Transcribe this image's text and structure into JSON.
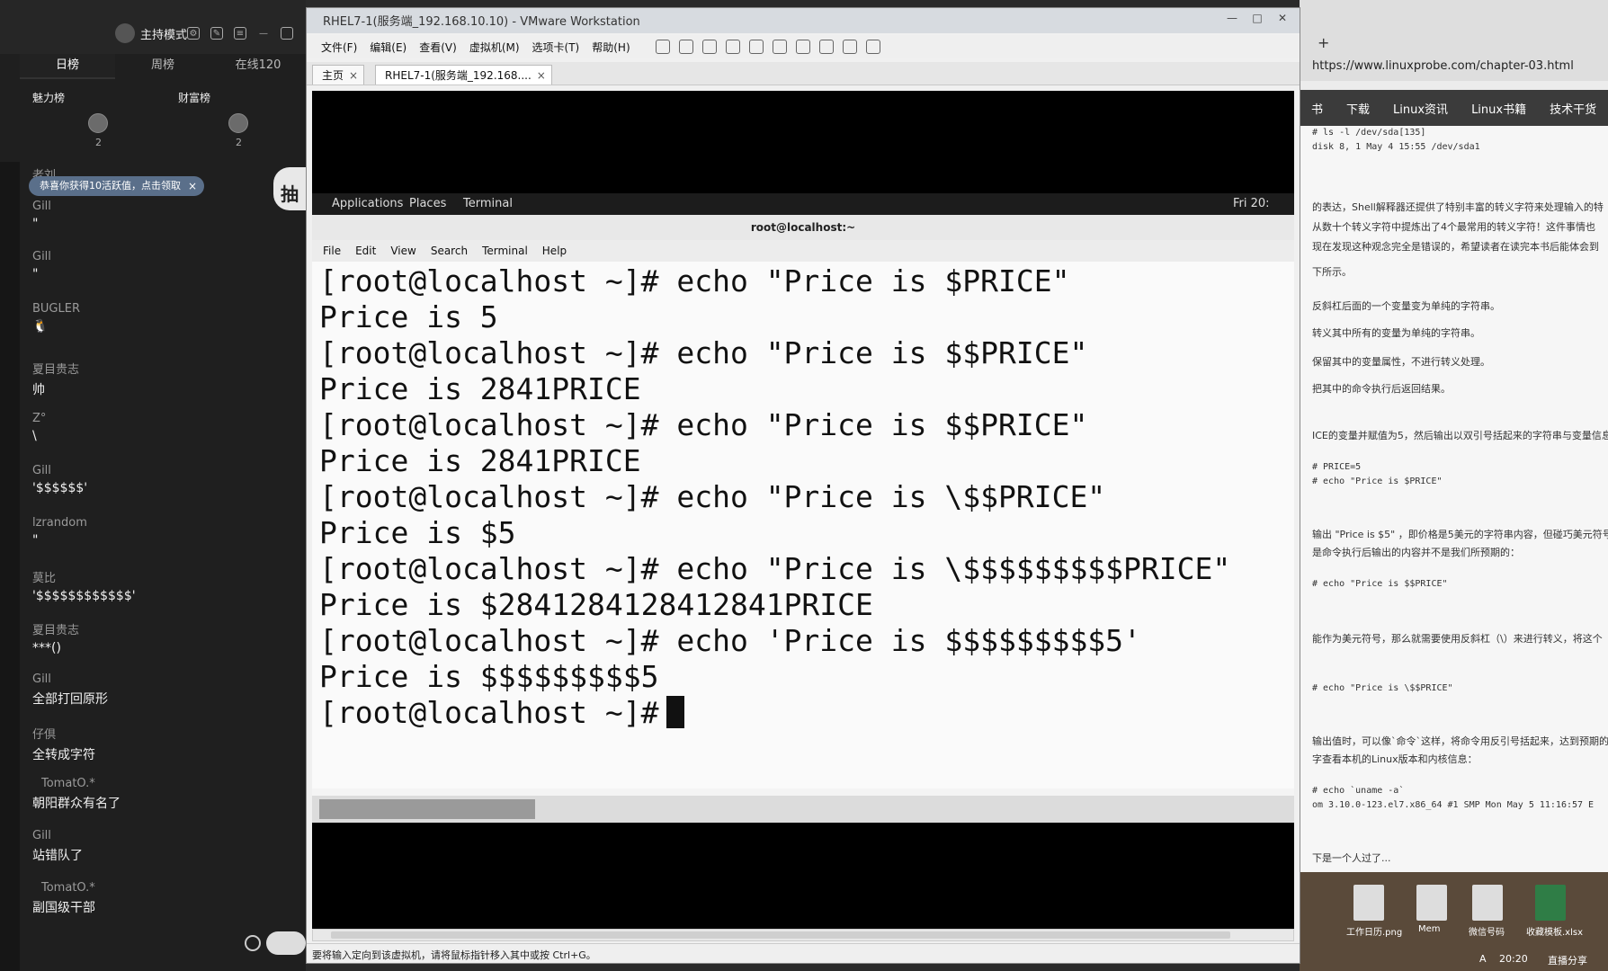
{
  "live": {
    "mode_label": "主持模式",
    "tabs": [
      "日榜",
      "周榜",
      "在线120"
    ],
    "rank": {
      "left_label": "魅力榜",
      "right_label": "财富榜",
      "left_count": "2",
      "right_count": "2"
    },
    "notice": "恭喜你获得10活跃值，点击领取",
    "notice_close": "×",
    "badge": "抽",
    "messages": [
      {
        "user": "老刘",
        "text": ""
      },
      {
        "user": "Gill",
        "text": "\""
      },
      {
        "user": "Gill",
        "text": "\""
      },
      {
        "user": "BUGLER",
        "text": "🐧"
      },
      {
        "user": "夏目贵志",
        "text": "帅"
      },
      {
        "user": "Z°",
        "text": "\\"
      },
      {
        "user": "Gill",
        "text": "'$$$$$$'"
      },
      {
        "user": "lzrandom",
        "text": "\""
      },
      {
        "user": "莫比",
        "text": "'$$$$$$$$$$$$'"
      },
      {
        "user": "夏目贵志",
        "text": "***()"
      },
      {
        "user": "Gill",
        "text": "全部打回原形"
      },
      {
        "user": "仔倶",
        "text": "全转成字符"
      },
      {
        "user": "TomatO.*",
        "text": "朝阳群众有名了"
      },
      {
        "user": "Gill",
        "text": "站错队了"
      },
      {
        "user": "TomatO.*",
        "text": "副国级干部"
      }
    ]
  },
  "vmware": {
    "title": "RHEL7-1(服务端_192.168.10.10) - VMware Workstation",
    "menu": [
      "文件(F)",
      "编辑(E)",
      "查看(V)",
      "虚拟机(M)",
      "选项卡(T)",
      "帮助(H)"
    ],
    "tabs": [
      {
        "label": "主页",
        "close": "×"
      },
      {
        "label": "RHEL7-1(服务端_192.168....",
        "close": "×"
      }
    ],
    "status": "要将输入定向到该虚拟机，请将鼠标指针移入其中或按 Ctrl+G。"
  },
  "gnome": {
    "panel": {
      "applications": "Applications",
      "places": "Places",
      "terminal": "Terminal",
      "clock": "Fri 20:"
    },
    "term_title": "root@localhost:~",
    "term_menu": [
      "File",
      "Edit",
      "View",
      "Search",
      "Terminal",
      "Help"
    ],
    "lines": [
      "[root@localhost ~]# echo \"Price is $PRICE\"",
      "Price is 5",
      "[root@localhost ~]# echo \"Price is $$PRICE\"",
      "Price is 2841PRICE",
      "[root@localhost ~]# echo \"Price is $$PRICE\"",
      "Price is 2841PRICE",
      "[root@localhost ~]# echo \"Price is \\$$PRICE\"",
      "Price is $5",
      "[root@localhost ~]# echo \"Price is \\$$$$$$$$$PRICE\"",
      "Price is $2841284128412841PRICE",
      "[root@localhost ~]# echo 'Price is $$$$$$$$$5'",
      "Price is $$$$$$$$$5"
    ],
    "prompt": "[root@localhost ~]#"
  },
  "browser": {
    "plus": "+",
    "url": "https://www.linuxprobe.com/chapter-03.html",
    "nav": [
      "书",
      "下载",
      "Linux资讯",
      "Linux书籍",
      "技术干货"
    ],
    "lines": [
      {
        "text": "# ls -l /dev/sda[135]",
        "code": true
      },
      {
        "text": "disk 8, 1 May 4 15:55 /dev/sda1",
        "code": true
      },
      {
        "text": "的表达，Shell解释器还提供了特别丰富的转义字符来处理输入的特",
        "code": false
      },
      {
        "text": "从数十个转义字符中提炼出了4个最常用的转义字符！这件事情也",
        "code": false
      },
      {
        "text": "现在发现这种观念完全是错误的，希望读者在读完本书后能体会到",
        "code": false
      },
      {
        "text": "下所示。",
        "code": false
      },
      {
        "text": "反斜杠后面的一个变量变为单纯的字符串。",
        "code": false
      },
      {
        "text": "转义其中所有的变量为单纯的字符串。",
        "code": false
      },
      {
        "text": "保留其中的变量属性，不进行转义处理。",
        "code": false
      },
      {
        "text": "把其中的命令执行后返回结果。",
        "code": false
      },
      {
        "text": "ICE的变量并赋值为5，然后输出以双引号括起来的字符串与变量信息",
        "code": false
      },
      {
        "text": "# PRICE=5",
        "code": true
      },
      {
        "text": "# echo \"Price is $PRICE\"",
        "code": true
      },
      {
        "text": "输出 \"Price is $5\" ，即价格是5美元的字符串内容，但碰巧美元符号",
        "code": false
      },
      {
        "text": "是命令执行后输出的内容并不是我们所预期的：",
        "code": false
      },
      {
        "text": "# echo \"Price is $$PRICE\"",
        "code": true
      },
      {
        "text": "能作为美元符号，那么就需要使用反斜杠（\\）来进行转义，将这个",
        "code": false
      },
      {
        "text": "# echo \"Price is \\$$PRICE\"",
        "code": true
      },
      {
        "text": "输出值时，可以像`命令`这样，将命令用反引号括起来，达到预期的",
        "code": false
      },
      {
        "text": "字查看本机的Linux版本和内核信息：",
        "code": false
      },
      {
        "text": "# echo `uname -a`",
        "code": true
      },
      {
        "text": "om 3.10.0-123.el7.x86_64 #1 SMP Mon May 5 11:16:57 E",
        "code": true
      },
      {
        "text": "下是一个人过了...",
        "code": false
      }
    ],
    "desktop_icons": [
      "工作日历.png",
      "Mem",
      "微信号码",
      "收藏模板.xlsx"
    ],
    "taskbar": [
      "A",
      "20:20",
      "直播分享"
    ]
  }
}
